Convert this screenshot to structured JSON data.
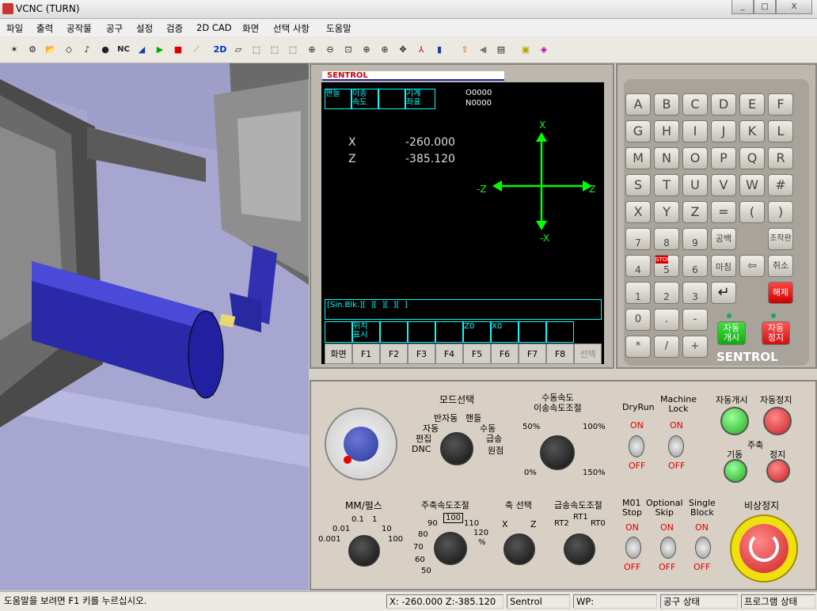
{
  "window": {
    "title": "VCNC (TURN)",
    "btn_min": "_",
    "btn_max": "□",
    "btn_close": "X"
  },
  "menu": [
    "파일",
    "출력",
    "공작물",
    "공구",
    "설정",
    "검증",
    "2D CAD",
    "화면",
    "선택 사항",
    "도움말"
  ],
  "toolbar": {
    "nc_label": "NC",
    "view2d_label": "2D"
  },
  "cnc": {
    "brand": "SENTROL",
    "header_cells": [
      "핸들",
      "이송\n속도",
      "",
      "기계\n좌표"
    ],
    "program_no": "O0000",
    "block_no": "N0000",
    "axis_x_label": "X",
    "axis_z_label": "Z",
    "x_value": "-260.000",
    "z_value": "-385.120",
    "cross_top": "X",
    "cross_bottom": "-X",
    "cross_left": "-Z",
    "cross_right": "Z",
    "single_block_line": "[Sin.Blk.][  ][  ][  ][  ]",
    "softkey_labels": [
      "",
      "위치\n표시",
      "",
      "",
      "",
      "Z0",
      "X0",
      "",
      ""
    ],
    "softkeys": [
      "화면",
      "F1",
      "F2",
      "F3",
      "F4",
      "F5",
      "F6",
      "F7",
      "F8",
      "선택"
    ]
  },
  "keypad": {
    "rows": [
      [
        "A",
        "B",
        "C",
        "D",
        "E",
        "F"
      ],
      [
        "G",
        "H",
        "I",
        "J",
        "K",
        "L"
      ],
      [
        "M",
        "N",
        "O",
        "P",
        "Q",
        "R"
      ],
      [
        "S",
        "T",
        "U",
        "V",
        "W",
        "#"
      ],
      [
        "X",
        "Y",
        "Z",
        "=",
        "(",
        ")"
      ]
    ],
    "numpad": [
      [
        "7",
        "8",
        "9"
      ],
      [
        "4",
        "5",
        "6"
      ],
      [
        "1",
        "2",
        "3"
      ],
      [
        "0",
        ".",
        "-"
      ],
      [
        "*",
        "/",
        "+"
      ]
    ],
    "space": "공백",
    "operate": "조작판",
    "input": "마침",
    "cancel": "취소",
    "release": "해제",
    "auto_start": "자동\n개시",
    "auto_stop": "자동\n정지",
    "stop_label": "STOP",
    "brand": "SENTROL"
  },
  "panel": {
    "mode_title": "모드선택",
    "mode_options": [
      "반자동",
      "핸들",
      "자동",
      "수동",
      "편집",
      "급송",
      "DNC",
      "원점"
    ],
    "feed_title": "수동속도\n이송속도조절",
    "feed_marks": [
      "50%",
      "100%",
      "0%",
      "150%"
    ],
    "dryrun": "DryRun",
    "machine_lock": "Machine\nLock",
    "on": "ON",
    "off": "OFF",
    "auto_start": "자동개시",
    "auto_stop": "자동정지",
    "spindle": "주축",
    "spindle_start": "기동",
    "spindle_stop": "정지",
    "mm_pulse": "MM/펄스",
    "mm_marks": [
      "0.1",
      "1",
      "0.01",
      "10",
      "0.001",
      "100"
    ],
    "spindle_speed": "주축속도조절",
    "spindle_marks": [
      "90",
      "100",
      "110",
      "80",
      "120",
      "%",
      "70",
      "60",
      "50"
    ],
    "axis_select": "축 선택",
    "axis_marks": [
      "X",
      "Z"
    ],
    "rapid": "급송속도조절",
    "rapid_marks": [
      "RT1",
      "RT2",
      "RT0"
    ],
    "m01": "M01\nStop",
    "opt_skip": "Optional\nSkip",
    "single_block": "Single\nBlock",
    "estop": "비상정지"
  },
  "status": {
    "help": "도움말을 보려면 F1 키를 누르십시오.",
    "coords": "X: -260.000  Z:-385.120",
    "controller": "Sentrol",
    "wp": "WP:",
    "tool_state": "공구 상태",
    "program_state": "프로그램 상태"
  }
}
